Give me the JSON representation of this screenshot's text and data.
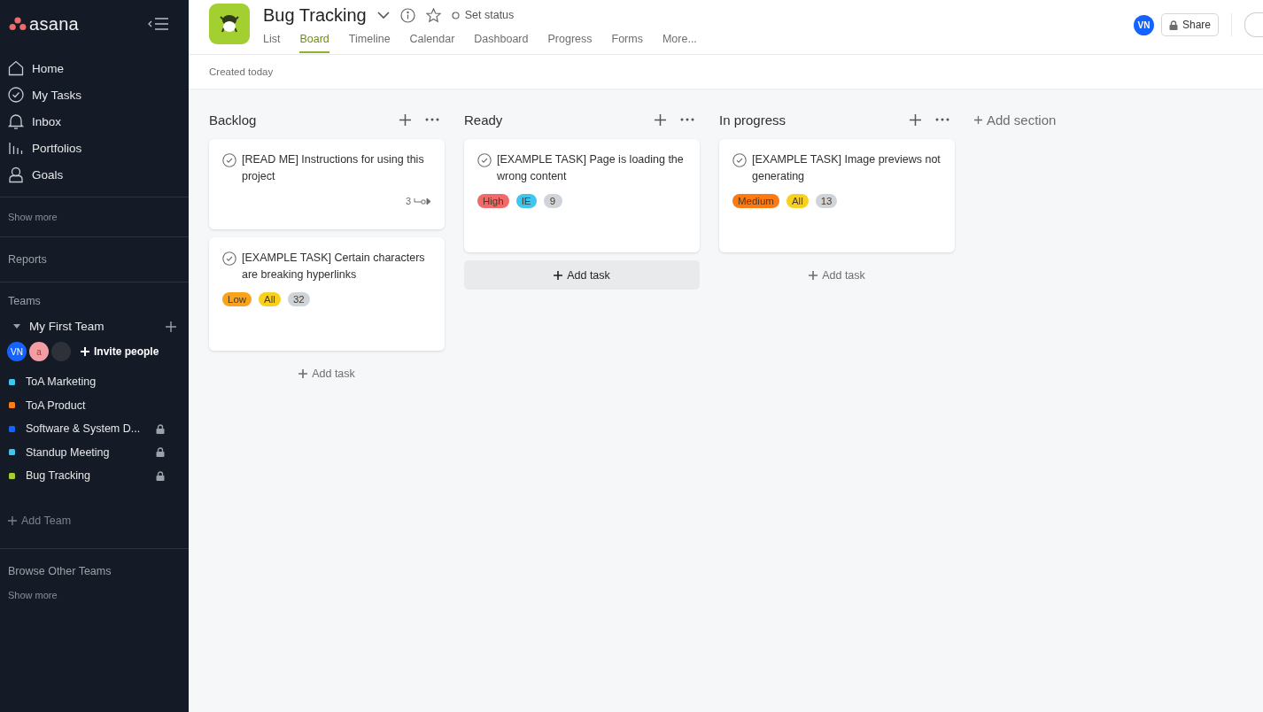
{
  "sidebar": {
    "logo": "asana",
    "nav": [
      {
        "label": "Home"
      },
      {
        "label": "My Tasks"
      },
      {
        "label": "Inbox"
      },
      {
        "label": "Portfolios"
      },
      {
        "label": "Goals"
      }
    ],
    "show_more": "Show more",
    "reports": "Reports",
    "teams_heading": "Teams",
    "team": {
      "name": "My First Team",
      "expanded": true,
      "avatars": [
        {
          "initials": "VN",
          "color": "#1463ff"
        },
        {
          "initials": "a",
          "color": "#f29ea3"
        },
        {
          "color": "#2e3238"
        }
      ],
      "invite": "Invite people"
    },
    "projects": [
      {
        "name": "ToA Marketing",
        "color": "#3ec6ef",
        "locked": false
      },
      {
        "name": "ToA Product",
        "color": "#fd7e14",
        "locked": false
      },
      {
        "name": "Software & System D...",
        "color": "#1464ff",
        "locked": true
      },
      {
        "name": "Standup Meeting",
        "color": "#3ec6ef",
        "locked": true
      },
      {
        "name": "Bug Tracking",
        "color": "#a4cf30",
        "locked": true
      }
    ],
    "add_team": "Add Team",
    "browse": "Browse Other Teams",
    "show_more_2": "Show more"
  },
  "header": {
    "title": "Bug Tracking",
    "set_status": "Set status",
    "tabs": [
      {
        "label": "List",
        "selected": false
      },
      {
        "label": "Board",
        "selected": true
      },
      {
        "label": "Timeline",
        "selected": false
      },
      {
        "label": "Calendar",
        "selected": false
      },
      {
        "label": "Dashboard",
        "selected": false
      },
      {
        "label": "Progress",
        "selected": false
      },
      {
        "label": "Forms",
        "selected": false
      },
      {
        "label": "More...",
        "selected": false
      }
    ],
    "avatar": "VN",
    "share": "Share",
    "created": "Created today"
  },
  "board": {
    "columns": [
      {
        "title": "Backlog",
        "add_task": "Add task",
        "add_task_hovered": false,
        "tasks": [
          {
            "title": "[READ ME] Instructions for using this project",
            "subtasks": "3"
          },
          {
            "title": "[EXAMPLE TASK] Certain characters are breaking hyperlinks",
            "tags": [
              {
                "label": "Low",
                "color": "#f8a31a"
              },
              {
                "label": "All",
                "color": "#f8d01e"
              },
              {
                "label": "32",
                "color": "#cfd4da"
              }
            ]
          }
        ]
      },
      {
        "title": "Ready",
        "add_task": "Add task",
        "add_task_hovered": true,
        "tasks": [
          {
            "title": "[EXAMPLE TASK] Page is loading the wrong content",
            "tags": [
              {
                "label": "High",
                "color": "#f06a6a"
              },
              {
                "label": "IE",
                "color": "#3ec6ef"
              },
              {
                "label": "9",
                "color": "#cfd4da"
              }
            ]
          }
        ]
      },
      {
        "title": "In progress",
        "add_task": "Add task",
        "add_task_hovered": false,
        "tasks": [
          {
            "title": "[EXAMPLE TASK] Image previews not generating",
            "tags": [
              {
                "label": "Medium",
                "color": "#fd7a12"
              },
              {
                "label": "All",
                "color": "#f8d01e"
              },
              {
                "label": "13",
                "color": "#cfd4da"
              }
            ]
          }
        ]
      }
    ],
    "add_section": "Add section"
  }
}
